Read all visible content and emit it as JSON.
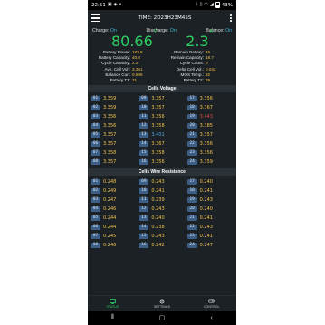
{
  "status_bar": {
    "time": "22:51",
    "battery": "43%",
    "icons_left": [
      "photo-icon",
      "notification-icon",
      "dot-icon"
    ],
    "icons_right": [
      "bluetooth-icon",
      "vibrate-icon",
      "wifi-icon",
      "signal-icon",
      "battery-icon"
    ]
  },
  "title_bar": {
    "title": "TIME: 2D23H23M45S"
  },
  "switches": {
    "charge_label": "Charge:",
    "charge_value": "On",
    "discharge_label": "Discharge:",
    "discharge_value": "On",
    "balance_label": "Balance:",
    "balance_value": "On"
  },
  "big": {
    "voltage": "80.66",
    "voltage_unit": "V",
    "current": "2.3",
    "current_unit": "A"
  },
  "info_left": [
    {
      "label": "Battery Power:",
      "value": "182.8"
    },
    {
      "label": "Battery Capacity:",
      "value": "40.0"
    },
    {
      "label": "Cycle Capacity:",
      "value": "2.2"
    },
    {
      "label": "Ave. Cell Vol.:",
      "value": "3.361"
    },
    {
      "label": "Balance Cur.:",
      "value": "0.596"
    },
    {
      "label": "Battery T1:",
      "value": "31"
    }
  ],
  "info_right": [
    {
      "label": "Remain Battery:",
      "value": "46"
    },
    {
      "label": "Remain Capacity:",
      "value": "18.7"
    },
    {
      "label": "Cycle Count:",
      "value": "0"
    },
    {
      "label": "Delta Cell Vol.:",
      "value": "0.042"
    },
    {
      "label": "MOS Temp.:",
      "value": "32"
    },
    {
      "label": "Battery T2:",
      "value": "29"
    }
  ],
  "voltage_section": {
    "title": "Cells Voltage",
    "cells": [
      {
        "n": "01",
        "v": "3.359",
        "state": "normal"
      },
      {
        "n": "09",
        "v": "3.357",
        "state": "normal"
      },
      {
        "n": "17",
        "v": "3.356",
        "state": "normal"
      },
      {
        "n": "02",
        "v": "3.359",
        "state": "normal"
      },
      {
        "n": "10",
        "v": "3.357",
        "state": "normal"
      },
      {
        "n": "18",
        "v": "3.367",
        "state": "normal"
      },
      {
        "n": "03",
        "v": "3.356",
        "state": "normal"
      },
      {
        "n": "11",
        "v": "3.356",
        "state": "normal"
      },
      {
        "n": "19",
        "v": "3.443",
        "state": "max"
      },
      {
        "n": "04",
        "v": "3.356",
        "state": "normal"
      },
      {
        "n": "12",
        "v": "3.358",
        "state": "normal"
      },
      {
        "n": "20",
        "v": "3.385",
        "state": "normal"
      },
      {
        "n": "05",
        "v": "3.357",
        "state": "normal"
      },
      {
        "n": "13",
        "v": "3.401",
        "state": "min"
      },
      {
        "n": "21",
        "v": "3.357",
        "state": "normal"
      },
      {
        "n": "06",
        "v": "3.357",
        "state": "normal"
      },
      {
        "n": "14",
        "v": "3.367",
        "state": "normal"
      },
      {
        "n": "22",
        "v": "3.356",
        "state": "normal"
      },
      {
        "n": "07",
        "v": "3.358",
        "state": "normal"
      },
      {
        "n": "15",
        "v": "3.358",
        "state": "normal"
      },
      {
        "n": "23",
        "v": "3.356",
        "state": "normal"
      },
      {
        "n": "08",
        "v": "3.357",
        "state": "normal"
      },
      {
        "n": "16",
        "v": "3.356",
        "state": "normal"
      },
      {
        "n": "24",
        "v": "3.359",
        "state": "normal"
      }
    ]
  },
  "resistance_section": {
    "title": "Cells Wire Resistance",
    "cells": [
      {
        "n": "01",
        "v": "0.248"
      },
      {
        "n": "09",
        "v": "0.243"
      },
      {
        "n": "17",
        "v": "0.240"
      },
      {
        "n": "02",
        "v": "0.249"
      },
      {
        "n": "10",
        "v": "0.241"
      },
      {
        "n": "18",
        "v": "0.241"
      },
      {
        "n": "03",
        "v": "0.247"
      },
      {
        "n": "11",
        "v": "0.239"
      },
      {
        "n": "19",
        "v": "0.243"
      },
      {
        "n": "04",
        "v": "0.246"
      },
      {
        "n": "12",
        "v": "0.243"
      },
      {
        "n": "20",
        "v": "0.240"
      },
      {
        "n": "05",
        "v": "0.244"
      },
      {
        "n": "13",
        "v": "0.240"
      },
      {
        "n": "21",
        "v": "0.241"
      },
      {
        "n": "06",
        "v": "0.244"
      },
      {
        "n": "14",
        "v": "0.238"
      },
      {
        "n": "22",
        "v": "0.243"
      },
      {
        "n": "07",
        "v": "0.245"
      },
      {
        "n": "15",
        "v": "0.243"
      },
      {
        "n": "23",
        "v": "0.241"
      },
      {
        "n": "08",
        "v": "0.246"
      },
      {
        "n": "16",
        "v": "0.242"
      },
      {
        "n": "24",
        "v": "0.247"
      }
    ]
  },
  "bottom_nav": {
    "status": "STATUS",
    "settings": "SETTINGS",
    "control": "CONTROL"
  },
  "colors": {
    "accent_green": "#2ecf62",
    "value_yellow": "#f2c14e",
    "on_blue": "#3fb7d9",
    "badge_blue": "#3d5f86",
    "max_red": "#e04848",
    "min_blue": "#5aa9e6",
    "background": "#1b2124"
  }
}
